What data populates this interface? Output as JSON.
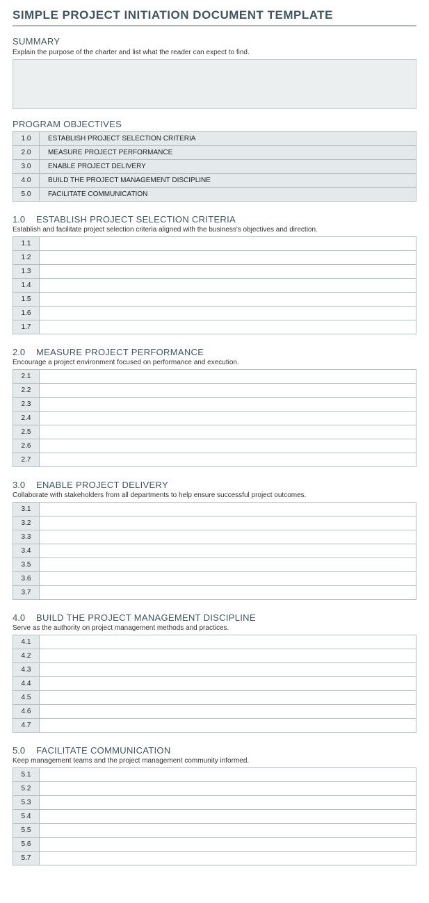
{
  "title": "SIMPLE PROJECT INITIATION DOCUMENT TEMPLATE",
  "summary": {
    "heading": "SUMMARY",
    "subtext": "Explain the purpose of the charter and list what the reader can expect to find."
  },
  "objectives": {
    "heading": "PROGRAM OBJECTIVES",
    "items": [
      {
        "num": "1.0",
        "text": "ESTABLISH PROJECT SELECTION CRITERIA"
      },
      {
        "num": "2.0",
        "text": "MEASURE PROJECT PERFORMANCE"
      },
      {
        "num": "3.0",
        "text": "ENABLE PROJECT DELIVERY"
      },
      {
        "num": "4.0",
        "text": "BUILD THE PROJECT MANAGEMENT DISCIPLINE"
      },
      {
        "num": "5.0",
        "text": "FACILITATE COMMUNICATION"
      }
    ]
  },
  "sections": [
    {
      "num": "1.0",
      "title": "ESTABLISH PROJECT SELECTION CRITERIA",
      "subtext": "Establish and facilitate project selection criteria aligned with the business's objectives and direction.",
      "rows": [
        "1.1",
        "1.2",
        "1.3",
        "1.4",
        "1.5",
        "1.6",
        "1.7"
      ]
    },
    {
      "num": "2.0",
      "title": "MEASURE PROJECT PERFORMANCE",
      "subtext": "Encourage a project environment focused on performance and execution.",
      "rows": [
        "2.1",
        "2.2",
        "2.3",
        "2.4",
        "2.5",
        "2.6",
        "2.7"
      ]
    },
    {
      "num": "3.0",
      "title": "ENABLE PROJECT DELIVERY",
      "subtext": "Collaborate with stakeholders from all departments to help ensure successful project outcomes.",
      "rows": [
        "3.1",
        "3.2",
        "3.3",
        "3.4",
        "3.5",
        "3.6",
        "3.7"
      ]
    },
    {
      "num": "4.0",
      "title": "BUILD THE PROJECT MANAGEMENT DISCIPLINE",
      "subtext": "Serve as the authority on project management methods and practices.",
      "rows": [
        "4.1",
        "4.2",
        "4.3",
        "4.4",
        "4.5",
        "4.6",
        "4.7"
      ]
    },
    {
      "num": "5.0",
      "title": "FACILITATE COMMUNICATION",
      "subtext": "Keep management teams and the project management community informed.",
      "rows": [
        "5.1",
        "5.2",
        "5.3",
        "5.4",
        "5.5",
        "5.6",
        "5.7"
      ]
    }
  ]
}
